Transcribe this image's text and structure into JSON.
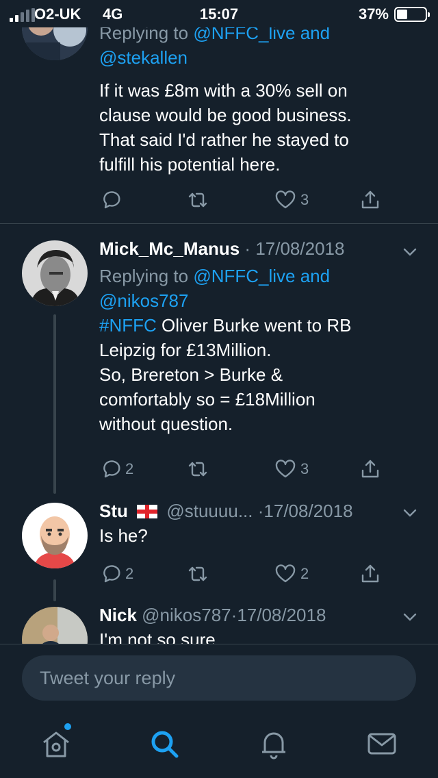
{
  "status_bar": {
    "carrier": "O2-UK",
    "network": "4G",
    "time": "15:07",
    "battery_percent": "37%",
    "battery_level": 0.37,
    "signal_bars": 2
  },
  "tweets": [
    {
      "replying_prefix": "Replying to",
      "replying_line1": "@NFFC_live and",
      "replying_line2": "@stekallen",
      "text_lines": [
        "If it was £8m with a 30% sell on",
        "clause would be good business.",
        "That said I'd rather he stayed to",
        "fulfill his potential here."
      ],
      "replies": "",
      "likes": "3"
    },
    {
      "name": "Mick_Mc_Manus",
      "separator": "·",
      "date": "17/08/2018",
      "replying_prefix": "Replying to",
      "replying_line1": "@NFFC_live and",
      "replying_line2": "@nikos787",
      "hashtag": "#NFFC",
      "text_line1_rest": " Oliver Burke went to RB",
      "text_lines": [
        "Leipzig for £13Million.",
        "So, Brereton > Burke  &",
        "comfortably so  =  £18Million",
        "without question."
      ],
      "replies": "2",
      "likes": "3"
    },
    {
      "name": "Stu",
      "flag": "England flag",
      "handle": "@stuuuu...",
      "separator": "·",
      "date": "17/08/2018",
      "text": "Is he?",
      "replies": "2",
      "likes": "2"
    },
    {
      "name": "Nick",
      "handle": "@nikos787",
      "separator": "·",
      "date": "17/08/2018",
      "text": "I'm not so sure"
    }
  ],
  "reply_bar": {
    "placeholder": "Tweet your reply"
  },
  "tab_bar": {
    "items": [
      "home-icon",
      "search-icon",
      "notifications-icon",
      "messages-icon"
    ],
    "active": "search-icon",
    "accent_color": "#1da1f2"
  },
  "colors": {
    "background": "#15202b",
    "text": "#ffffff",
    "muted": "#8899a6",
    "link": "#1da1f2",
    "divider": "#38444d"
  }
}
